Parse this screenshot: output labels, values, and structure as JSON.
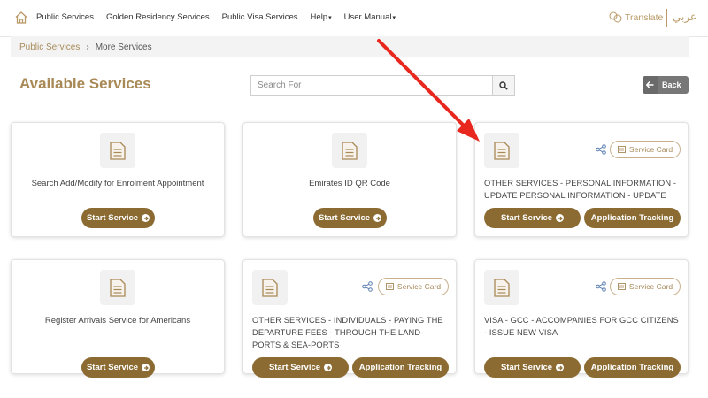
{
  "nav": {
    "items": [
      {
        "label": "Public Services",
        "has_caret": false
      },
      {
        "label": "Golden Residency Services",
        "has_caret": false
      },
      {
        "label": "Public Visa Services",
        "has_caret": false
      },
      {
        "label": "Help",
        "has_caret": true
      },
      {
        "label": "User Manual",
        "has_caret": true
      }
    ],
    "caret": "▾",
    "translate_label": "Translate",
    "arabic_label": "عربي"
  },
  "breadcrumb": {
    "items": [
      "Public Services",
      "More Services"
    ],
    "separator": "›"
  },
  "header": {
    "title": "Available Services",
    "search_placeholder": "Search For",
    "back_label": "Back"
  },
  "cards": [
    {
      "title": "Search Add/Modify for Enrolment Appointment",
      "start_label": "Start Service",
      "has_tracking": false
    },
    {
      "title": "Emirates ID QR Code",
      "start_label": "Start Service",
      "has_tracking": false
    },
    {
      "title": "OTHER SERVICES - PERSONAL INFORMATION - UPDATE PERSONAL INFORMATION - UPDATE",
      "start_label": "Start Service",
      "tracking_label": "Application Tracking",
      "service_card_label": "Service Card",
      "has_tracking": true
    },
    {
      "title": "Register Arrivals Service for Americans",
      "start_label": "Start Service",
      "has_tracking": false
    },
    {
      "title": "OTHER SERVICES - INDIVIDUALS - PAYING THE DEPARTURE FEES - THROUGH THE LAND-PORTS & SEA-PORTS",
      "start_label": "Start Service",
      "tracking_label": "Application Tracking",
      "service_card_label": "Service Card",
      "has_tracking": true
    },
    {
      "title": "VISA - GCC - ACCOMPANIES FOR GCC CITIZENS - ISSUE NEW VISA",
      "start_label": "Start Service",
      "tracking_label": "Application Tracking",
      "service_card_label": "Service Card",
      "has_tracking": true
    }
  ],
  "colors": {
    "brand_gold": "#a88956",
    "button_brown": "#8b6b32",
    "annotation_red": "#e8271e"
  },
  "icons": [
    "home-icon",
    "translate-icon",
    "search-icon",
    "back-arrow-icon",
    "document-icon",
    "share-icon",
    "service-card-icon",
    "arrow-circle-icon"
  ]
}
